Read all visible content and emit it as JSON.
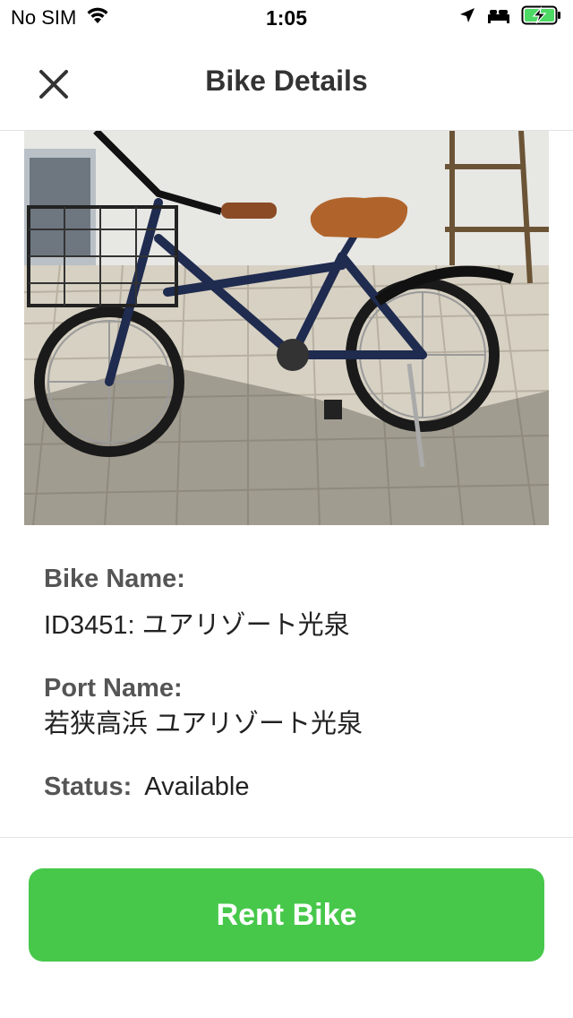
{
  "status_bar": {
    "carrier": "No SIM",
    "time": "1:05",
    "icons": [
      "wifi-icon",
      "location-arrow-icon",
      "bed-icon",
      "battery-charging-icon"
    ],
    "battery_color": "#4cd964"
  },
  "header": {
    "title": "Bike Details",
    "close_icon": "close-icon"
  },
  "photo": {
    "description_icon": "bike-photo"
  },
  "details": {
    "bike_name_label": "Bike Name:",
    "bike_name_value": "ID3451: ユアリゾート光泉",
    "port_name_label": "Port Name:",
    "port_name_value": "若狭高浜 ユアリゾート光泉",
    "status_label": "Status:",
    "status_value": "Available"
  },
  "footer": {
    "rent_button_label": "Rent Bike",
    "accent_color": "#47c84b"
  }
}
